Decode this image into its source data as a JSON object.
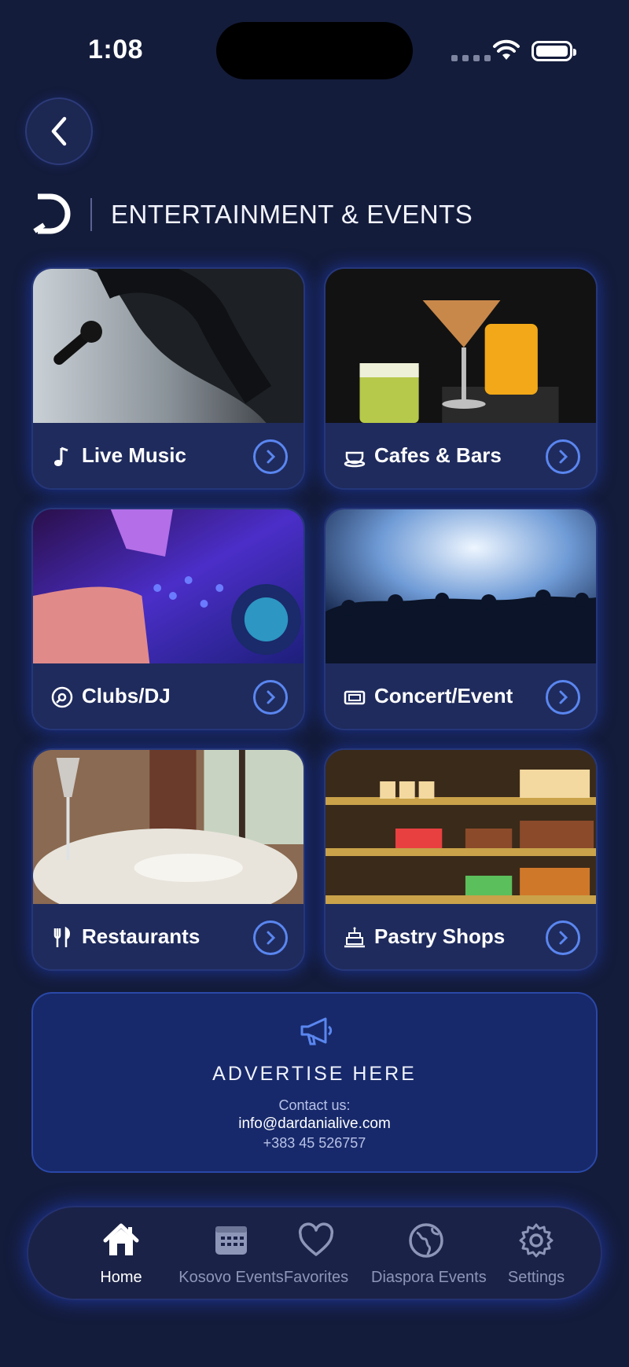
{
  "status_bar": {
    "time": "1:08"
  },
  "header": {
    "title": "ENTERTAINMENT & EVENTS"
  },
  "categories": [
    {
      "label": "Live Music",
      "icon": "music-note-icon"
    },
    {
      "label": "Cafes & Bars",
      "icon": "coffee-cup-icon"
    },
    {
      "label": "Clubs/DJ",
      "icon": "vinyl-disc-icon"
    },
    {
      "label": "Concert/Event",
      "icon": "ticket-icon"
    },
    {
      "label": "Restaurants",
      "icon": "fork-knife-icon"
    },
    {
      "label": "Pastry Shops",
      "icon": "cake-icon"
    }
  ],
  "ad": {
    "title": "ADVERTISE HERE",
    "contact_label": "Contact us:",
    "email": "info@dardanialive.com",
    "phone": "+383 45 526757"
  },
  "tabs": [
    {
      "label": "Home",
      "icon": "home-icon",
      "active": true
    },
    {
      "label": "Kosovo Events",
      "icon": "calendar-icon",
      "active": false
    },
    {
      "label": "Favorites",
      "icon": "heart-icon",
      "active": false
    },
    {
      "label": "Diaspora Events",
      "icon": "globe-icon",
      "active": false
    },
    {
      "label": "Settings",
      "icon": "gear-icon",
      "active": false
    }
  ],
  "colors": {
    "background": "#141c3b",
    "accent": "#5a86f0",
    "card": "#1f2b5d",
    "glow": "#2548e6"
  }
}
